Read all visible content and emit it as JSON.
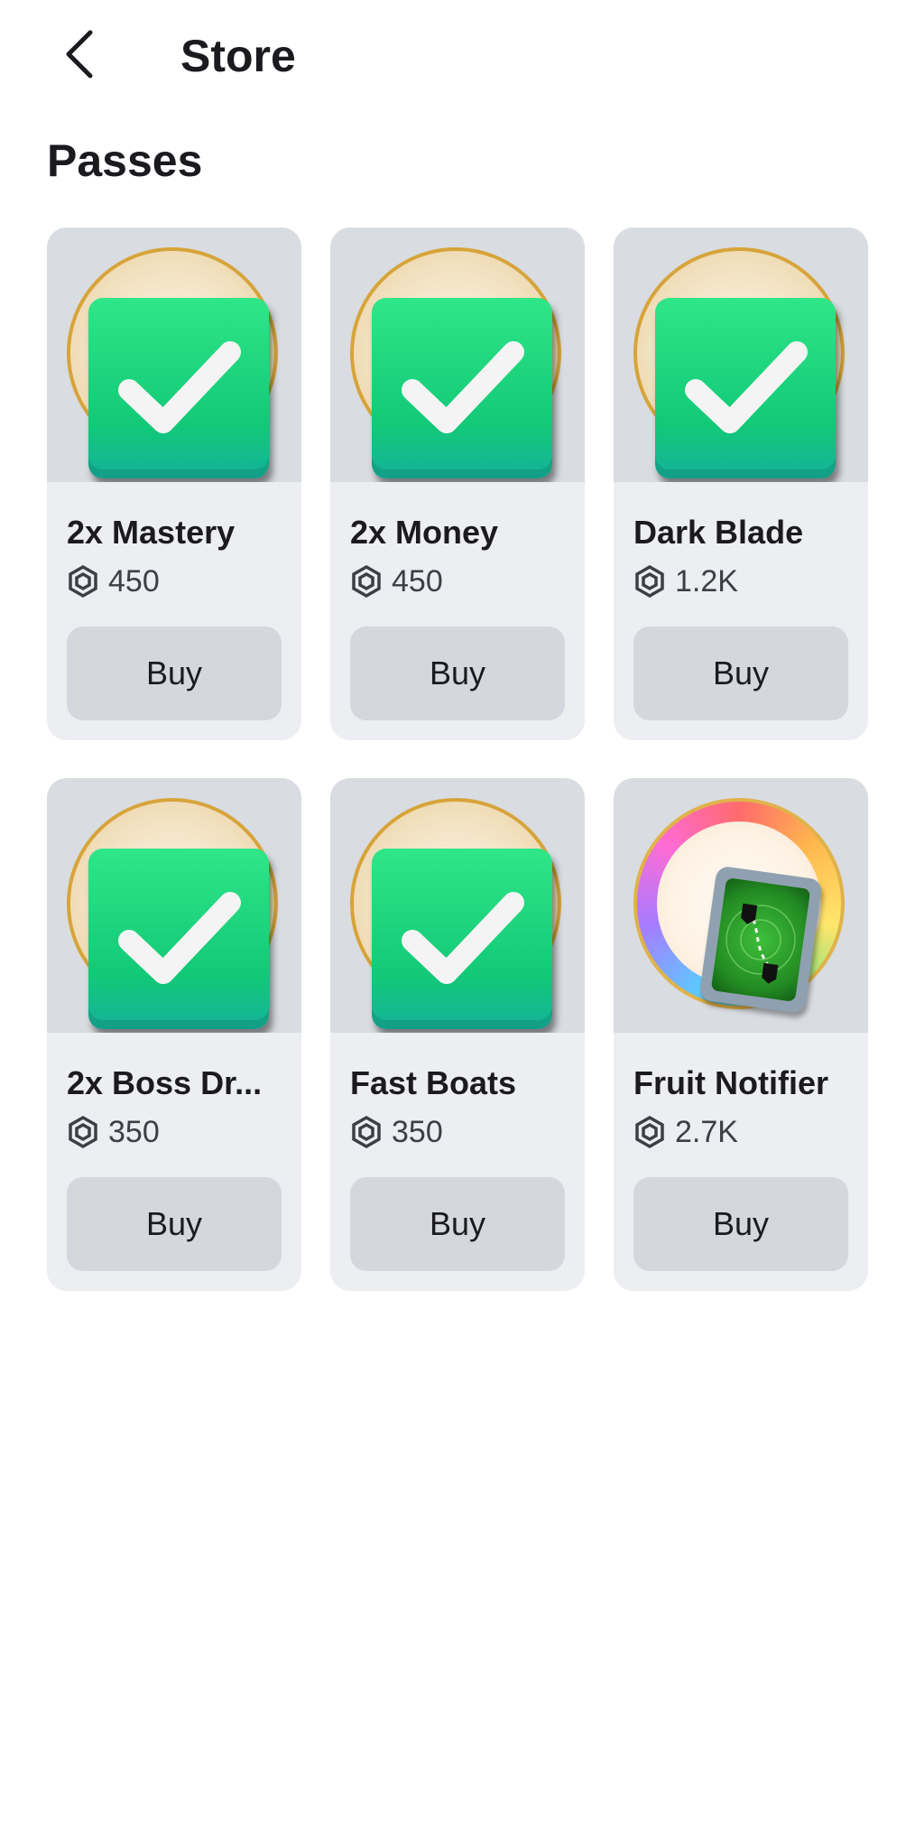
{
  "header": {
    "title": "Store",
    "back_icon": "chevron-left-icon"
  },
  "section": {
    "title": "Passes"
  },
  "colors": {
    "card_bg": "#eceef1",
    "thumb_bg": "#d9dce1",
    "button_bg": "#d4d7dd",
    "owned_green": "#12c977"
  },
  "passes": [
    {
      "name": "2x Mastery",
      "price": "450",
      "button": "Buy",
      "owned": true,
      "icon": "checkmark-owned-icon"
    },
    {
      "name": "2x Money",
      "price": "450",
      "button": "Buy",
      "owned": true,
      "icon": "checkmark-owned-icon"
    },
    {
      "name": "Dark Blade",
      "price": "1.2K",
      "button": "Buy",
      "owned": true,
      "icon": "checkmark-owned-icon"
    },
    {
      "name": "2x Boss Dr...",
      "price": "350",
      "button": "Buy",
      "owned": true,
      "icon": "checkmark-owned-icon"
    },
    {
      "name": "Fast Boats",
      "price": "350",
      "button": "Buy",
      "owned": true,
      "icon": "checkmark-owned-icon"
    },
    {
      "name": "Fruit Notifier",
      "price": "2.7K",
      "button": "Buy",
      "owned": false,
      "icon": "fruit-notifier-icon"
    }
  ]
}
